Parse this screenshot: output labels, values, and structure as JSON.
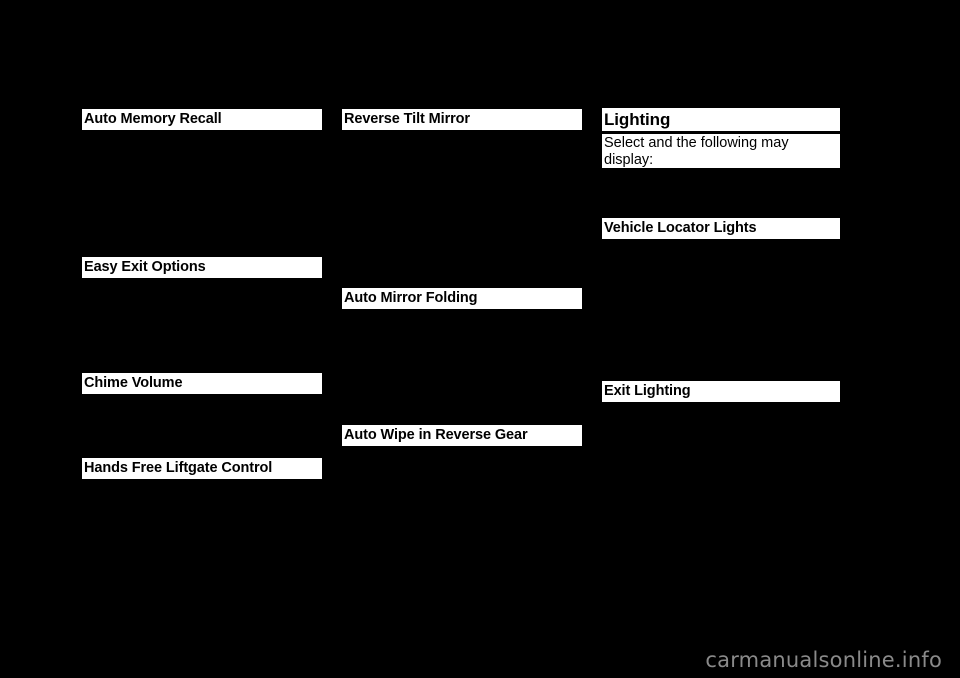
{
  "page": {
    "background_color": "#000000",
    "highlight_color": "#ffffff",
    "text_color": "#000000",
    "watermark": "carmanualsonline.info",
    "watermark_color": "#8a8a8a"
  },
  "columns": [
    {
      "name": "column-left",
      "blocks": [
        {
          "type": "heading",
          "text": "Auto Memory Recall"
        },
        {
          "type": "heading",
          "text": "Easy Exit Options"
        },
        {
          "type": "heading",
          "text": "Chime Volume"
        },
        {
          "type": "heading",
          "text": "Hands Free Liftgate Control"
        }
      ]
    },
    {
      "name": "column-middle",
      "blocks": [
        {
          "type": "heading",
          "text": "Reverse Tilt Mirror"
        },
        {
          "type": "heading",
          "text": "Auto Mirror Folding"
        },
        {
          "type": "heading",
          "text": "Auto Wipe in Reverse Gear"
        }
      ]
    },
    {
      "name": "column-right",
      "blocks": [
        {
          "type": "section-heading",
          "text": "Lighting"
        },
        {
          "type": "paragraph",
          "text": "Select and the following may display:"
        },
        {
          "type": "heading",
          "text": "Vehicle Locator Lights"
        },
        {
          "type": "heading",
          "text": "Exit Lighting"
        }
      ]
    }
  ]
}
